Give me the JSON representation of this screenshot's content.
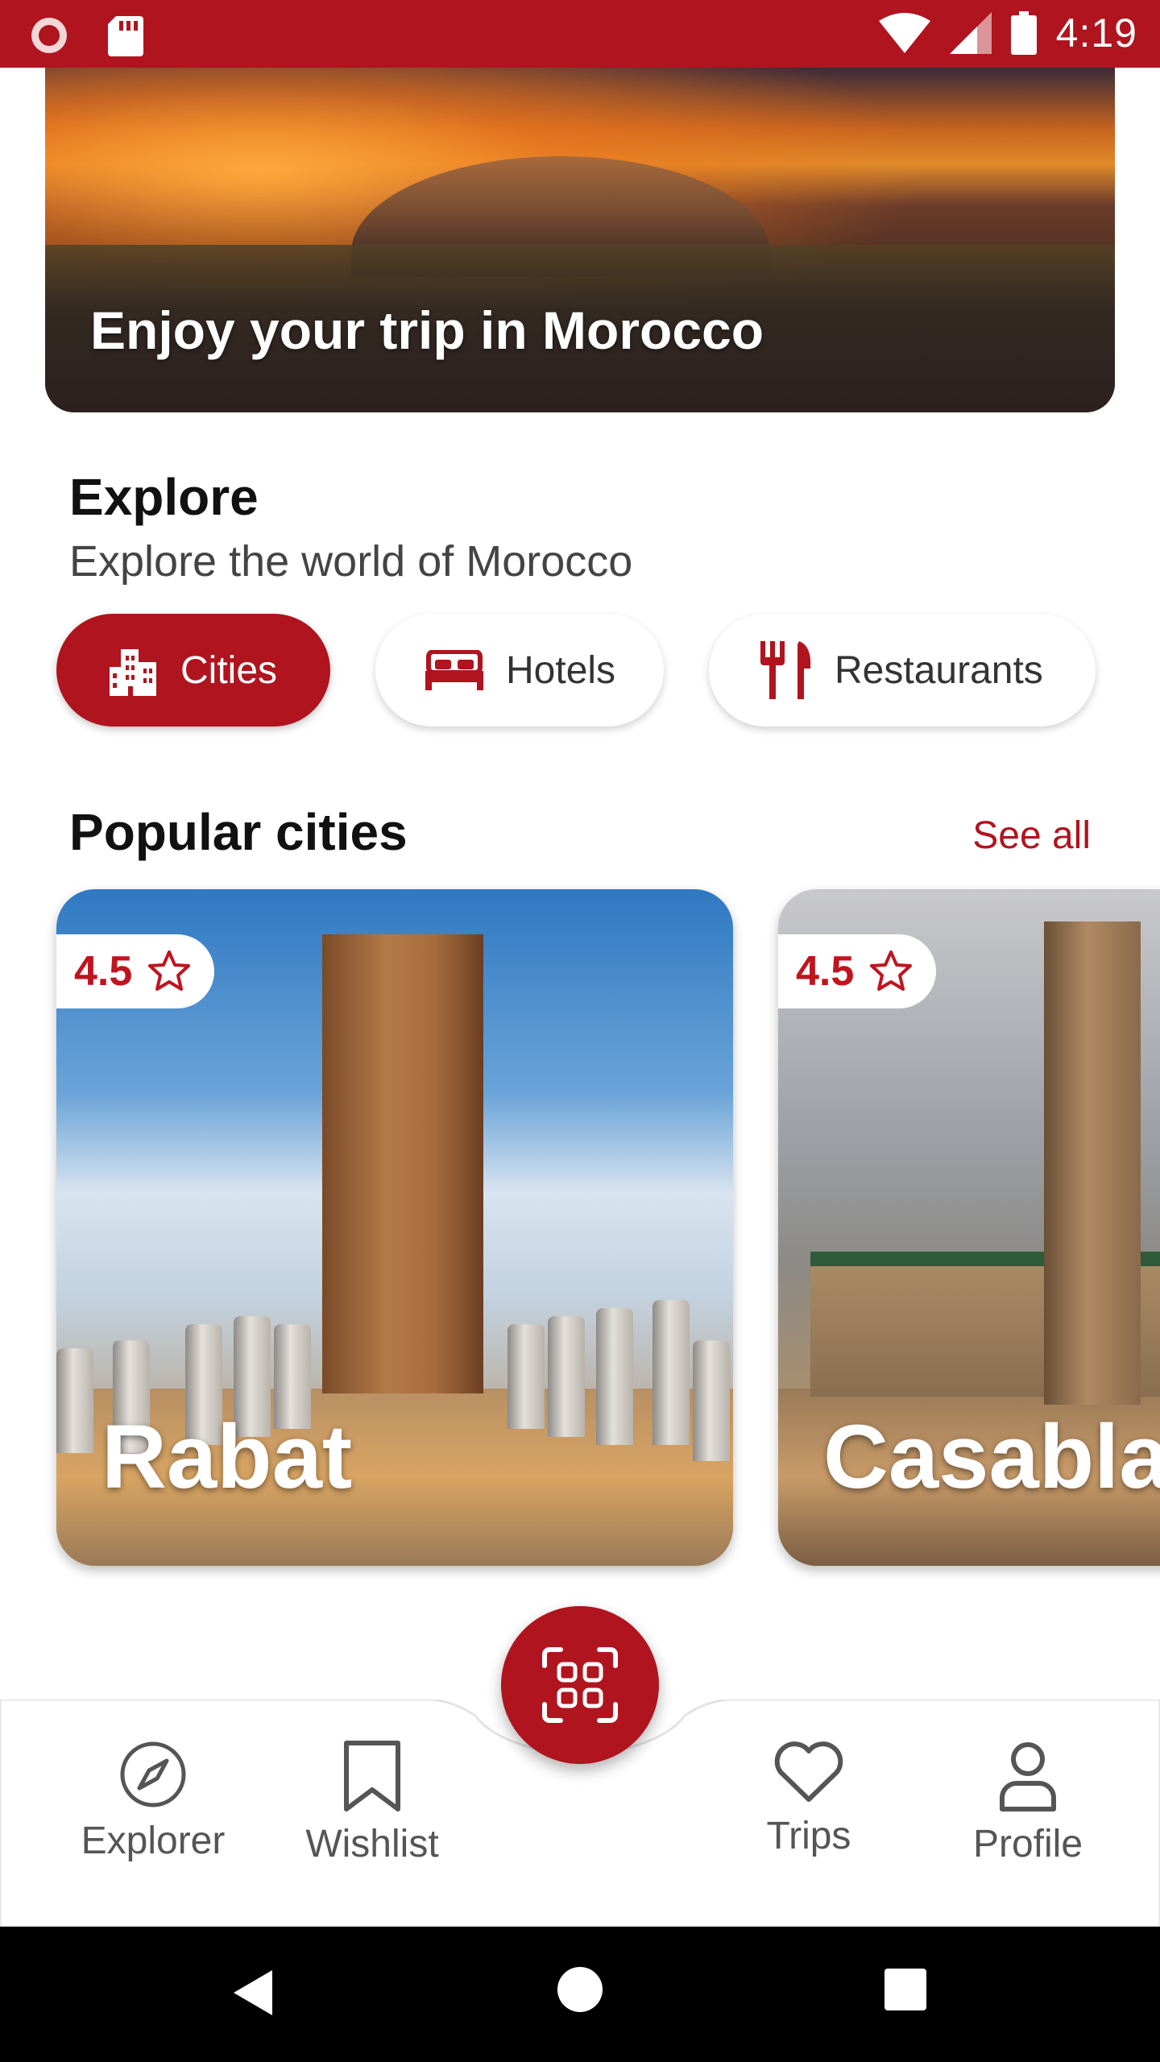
{
  "status_bar": {
    "time": "4:19",
    "bg_color": "#b0141e",
    "left_icons": [
      "record-icon",
      "sd-card-icon"
    ],
    "right_icons": [
      "wifi-icon",
      "signal-icon",
      "battery-icon"
    ]
  },
  "hero": {
    "title": "Enjoy your trip in Morocco"
  },
  "explore": {
    "title": "Explore",
    "subtitle": "Explore the world of Morocco",
    "chips": [
      {
        "label": "Cities",
        "icon": "city-icon",
        "active": true
      },
      {
        "label": "Hotels",
        "icon": "bed-icon",
        "active": false
      },
      {
        "label": "Restaurants",
        "icon": "fork-knife-icon",
        "active": false
      }
    ]
  },
  "popular": {
    "title": "Popular cities",
    "see_all": "See all",
    "cities": [
      {
        "name": "Rabat",
        "rating": "4.5"
      },
      {
        "name": "Casablanca",
        "rating": "4.5"
      }
    ]
  },
  "bottom_nav": {
    "items": [
      {
        "label": "Explorer",
        "icon": "compass-icon"
      },
      {
        "label": "Wishlist",
        "icon": "bookmark-icon"
      },
      {
        "label": "Trips",
        "icon": "heart-icon"
      },
      {
        "label": "Profile",
        "icon": "user-icon"
      }
    ],
    "fab_icon": "qr-scan-icon"
  },
  "system_nav": {
    "icons": [
      "back-icon",
      "home-icon",
      "recents-icon"
    ]
  },
  "colors": {
    "accent": "#b0141e",
    "rating": "#c0141e",
    "text_primary": "#111111",
    "text_secondary": "#444444"
  }
}
